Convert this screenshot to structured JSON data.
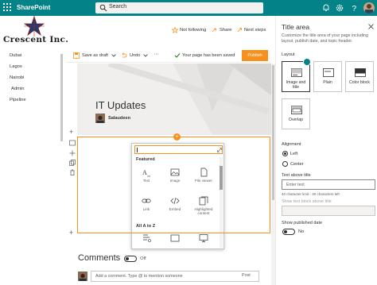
{
  "topbar": {
    "app_name": "SharePoint",
    "search_placeholder": "Search"
  },
  "site": {
    "logo_text": "Crescent Inc."
  },
  "nav": {
    "items": [
      "Dubai",
      "Lagos",
      "Nairobi",
      "Admin",
      "Pipeline"
    ]
  },
  "header_actions": {
    "follow": "Not following",
    "share": "Share",
    "next_steps": "Next steps"
  },
  "commandbar": {
    "save_as_draft": "Save as draft",
    "undo": "Undo",
    "saved_status": "Your page has been saved",
    "publish": "Publish"
  },
  "hero": {
    "title": "IT Updates",
    "author": "Salaudeen"
  },
  "toolbox": {
    "featured_label": "Featured",
    "all_label": "All A to Z",
    "items": [
      "Text",
      "Image",
      "File viewer",
      "Link",
      "Embed",
      "Highlighted content"
    ]
  },
  "comments": {
    "title": "Comments",
    "toggle_state": "Off",
    "input_placeholder": "Add a comment. Type @ to mention someone",
    "post": "Post"
  },
  "panel": {
    "title": "Title area",
    "description": "Customize the title area of your page including layout, publish date, and topic header.",
    "layout_label": "Layout",
    "layouts": [
      "Image and title",
      "Plain",
      "Color block",
      "Overlap"
    ],
    "selected_layout": "Image and title",
    "alignment_label": "Alignment",
    "alignments": [
      "Left",
      "Center"
    ],
    "selected_alignment": "Left",
    "text_above_label": "Text above title",
    "text_above_placeholder": "Enter text",
    "text_above_hint": "40 character limit - 40 characters left",
    "show_textblock_label": "Show text block above title",
    "show_date_label": "Show published date",
    "show_date_state": "No"
  },
  "colors": {
    "suite_bar": "#038387",
    "accent": "#f7911d"
  }
}
